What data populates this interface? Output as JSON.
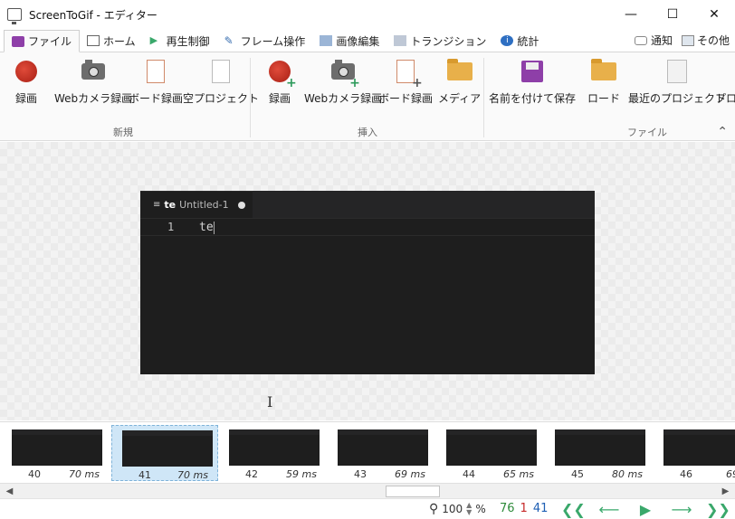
{
  "window": {
    "title": "ScreenToGif - エディター"
  },
  "tabs": [
    {
      "label": "ファイル",
      "icon": "save-icon",
      "active": true
    },
    {
      "label": "ホーム",
      "icon": "home-icon",
      "active": false
    },
    {
      "label": "再生制御",
      "icon": "play-icon",
      "active": false
    },
    {
      "label": "フレーム操作",
      "icon": "pencil-icon",
      "active": false
    },
    {
      "label": "画像編集",
      "icon": "image-icon",
      "active": false
    },
    {
      "label": "トランジション",
      "icon": "transition-icon",
      "active": false
    },
    {
      "label": "統計",
      "icon": "info-icon",
      "active": false
    }
  ],
  "tabs_right": {
    "notify": "通知",
    "other": "その他"
  },
  "ribbon": {
    "groups": [
      {
        "label": "新規",
        "buttons": [
          "録画",
          "Webカメラ録画",
          "ボード録画",
          "空プロジェクト"
        ]
      },
      {
        "label": "挿入",
        "buttons": [
          "録画",
          "Webカメラ録画",
          "ボード録画",
          "メディア"
        ]
      },
      {
        "label": "ファイル",
        "buttons": [
          "名前を付けて保存",
          "ロード",
          "最近のプロジェクト",
          "プロ"
        ]
      }
    ]
  },
  "editor": {
    "tab_prefix": "te",
    "tab_title": "Untitled-1",
    "line_number": "1",
    "text": "te"
  },
  "frames": [
    {
      "id": "40",
      "ms": "70 ms",
      "selected": false
    },
    {
      "id": "41",
      "ms": "70 ms",
      "selected": true
    },
    {
      "id": "42",
      "ms": "59 ms",
      "selected": false
    },
    {
      "id": "43",
      "ms": "69 ms",
      "selected": false
    },
    {
      "id": "44",
      "ms": "65 ms",
      "selected": false
    },
    {
      "id": "45",
      "ms": "80 ms",
      "selected": false
    },
    {
      "id": "46",
      "ms": "69",
      "selected": false
    }
  ],
  "status": {
    "zoom": "100",
    "zoom_unit": "%",
    "total_frames": "76",
    "selected_count": "1",
    "current_frame": "41",
    "colors": {
      "total": "#2e8b3a",
      "selected": "#c62828",
      "current": "#1e5fb4",
      "nav": "#3aa86b"
    }
  }
}
